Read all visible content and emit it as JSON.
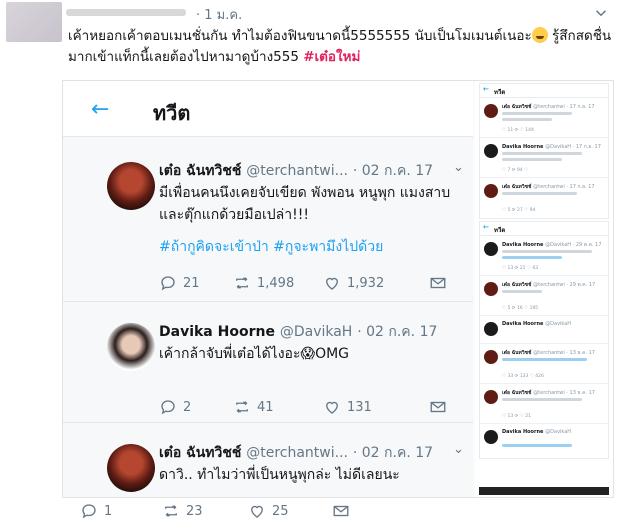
{
  "header": {
    "date": "· 1 ม.ค.",
    "caption_text": "เค้าหยอกเค้าตอบเมนชั่นกัน ทำไมต้องฟินขนาดนี้5555555 นับเป็นโมเมนต์เนอะ",
    "caption_text_2": " รู้สึกสดชื่นมากเข้าแท็กนี้เลยต้องไปหามาดูบ้าง555 ",
    "hashtag": "#เต๋อใหม่"
  },
  "screenshot": {
    "topbar_title": "ทวีต",
    "tweets": [
      {
        "name": "เต๋อ ฉันทวิชช์",
        "handle": "@terchantwi...",
        "date": "· 02 ก.ค. 17",
        "text": "มีเพื่อนคนนึงเคยจับเขียด พังพอน หนูพุก แมงสาบและตุ๊กแกด้วยมือเปล่า!!!",
        "hashtags": "#ถ้ากูคิดจะเข้าป่า #กูจะพามึงไปด้วย",
        "replies": "21",
        "retweets": "1,498",
        "likes": "1,932"
      },
      {
        "name": "Davika Hoorne",
        "handle": "@DavikaH",
        "date": "· 02 ก.ค. 17",
        "text": "เค้ากล้าจับพี่เต๋อได้ไงอะ😱OMG",
        "replies": "2",
        "retweets": "41",
        "likes": "131"
      },
      {
        "name": "เต๋อ ฉันทวิชช์",
        "handle": "@terchantwi...",
        "date": "· 02 ก.ค. 17",
        "text": "ดาวิ.. ทำไมว่าพี่เป็นหนูพุกล่ะ ไม่ดีเลยนะ",
        "replies": "1",
        "retweets": "23",
        "likes": "25"
      }
    ],
    "mini": {
      "card1_title": "ทวีต",
      "card2_title": "ทวีต",
      "rows": [
        {
          "name": "เต๋อ ฉันทวิชช์",
          "handle": "@terchantwi · 17 ก.ย. 17",
          "acts": "♡ 11   ⟳   ♡ 144"
        },
        {
          "name": "Davika Hoorne",
          "handle": "@DavikaH · 17 ก.ย. 17",
          "acts": "♡ 7   ⟳ 94   ♡"
        },
        {
          "name": "เต๋อ ฉันทวิชช์",
          "handle": "@terchantwi · 17 ก.ย. 17",
          "acts": "♡ 5   ⟳ 27   ♡ 94"
        },
        {
          "name": "Davika Hoorne",
          "handle": "@DavikaH · 29 ต.ค. 17",
          "acts": "♡ 13   ⟳ 21   ♡ 63"
        },
        {
          "name": "เต๋อ ฉันทวิชช์",
          "handle": "@terchantwi · 29 ต.ค. 17",
          "acts": "♡ 5   ⟳ 16   ♡ 195"
        },
        {
          "name": "Davika Hoorne",
          "handle": "@DavikaH",
          "acts": ""
        },
        {
          "name": "เต๋อ ฉันทวิชช์",
          "handle": "@terchantwi · 13 ธ.ค. 17",
          "acts": "♡ 33   ⟳ 133   ♡ 426"
        },
        {
          "name": "เต๋อ ฉันทวิชช์",
          "handle": "@terchantwi · 13 ธ.ค. 17",
          "acts": "♡ 13   ⟳   ♡ 21"
        },
        {
          "name": "Davika Hoorne",
          "handle": "@DavikaH",
          "acts": ""
        }
      ]
    }
  },
  "footer": {
    "replies": "1",
    "retweets": "23",
    "likes": "25"
  },
  "colors": {
    "accent": "#1da1f2",
    "hashtag_pink": "#e0245e",
    "muted": "#657786"
  }
}
